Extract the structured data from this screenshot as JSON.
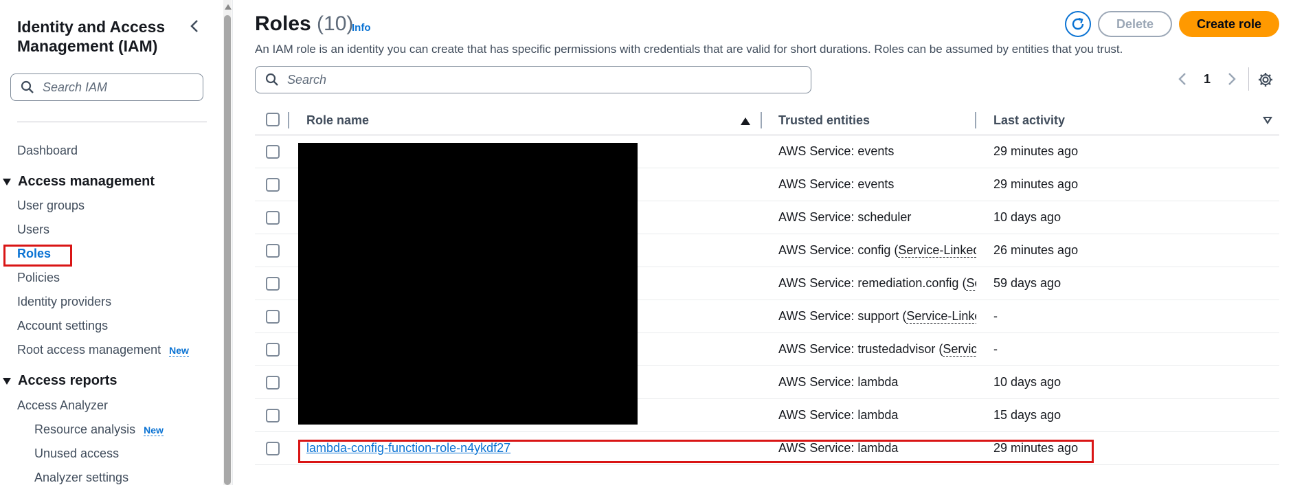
{
  "sidebar": {
    "title": "Identity and Access Management (IAM)",
    "search_placeholder": "Search IAM",
    "dashboard": "Dashboard",
    "access_management": {
      "heading": "Access management",
      "items": [
        "User groups",
        "Users",
        "Roles",
        "Policies",
        "Identity providers",
        "Account settings",
        "Root access management"
      ],
      "new_badge": "New"
    },
    "access_reports": {
      "heading": "Access reports",
      "analyzer": "Access Analyzer",
      "sub_items": [
        "Resource analysis",
        "Unused access",
        "Analyzer settings"
      ],
      "new_badge": "New"
    }
  },
  "header": {
    "title": "Roles",
    "count": "(10)",
    "info": "Info",
    "description": "An IAM role is an identity you can create that has specific permissions with credentials that are valid for short durations. Roles can be assumed by entities that you trust.",
    "delete_label": "Delete",
    "create_label": "Create role"
  },
  "search": {
    "placeholder": "Search"
  },
  "pagination": {
    "current_page": "1"
  },
  "table": {
    "columns": [
      "Role name",
      "Trusted entities",
      "Last activity"
    ],
    "rows": [
      {
        "name": "",
        "trusted": "AWS Service: events",
        "trusted_suffix": "",
        "activity": "29 minutes ago"
      },
      {
        "name": "",
        "trusted": "AWS Service: events",
        "trusted_suffix": "",
        "activity": "29 minutes ago"
      },
      {
        "name": "",
        "trusted": "AWS Service: scheduler",
        "trusted_suffix": "",
        "activity": "10 days ago"
      },
      {
        "name": "",
        "trusted": "AWS Service: config (",
        "trusted_suffix": "Service-Linked",
        "activity": "26 minutes ago"
      },
      {
        "name": "",
        "trusted": "AWS Service: remediation.config (",
        "trusted_suffix": "Service-Linked",
        "activity": "59 days ago"
      },
      {
        "name": "",
        "trusted": "AWS Service: support (",
        "trusted_suffix": "Service-Linked",
        "activity": "-"
      },
      {
        "name": "",
        "trusted": "AWS Service: trustedadvisor (",
        "trusted_suffix": "Service-Linked",
        "activity": "-"
      },
      {
        "name": "",
        "trusted": "AWS Service: lambda",
        "trusted_suffix": "",
        "activity": "10 days ago"
      },
      {
        "name": "",
        "trusted": "AWS Service: lambda",
        "trusted_suffix": "",
        "activity": "15 days ago"
      },
      {
        "name": "lambda-config-function-role-n4ykdf27",
        "trusted": "AWS Service: lambda",
        "trusted_suffix": "",
        "activity": "29 minutes ago"
      }
    ]
  },
  "colors": {
    "accent": "#0972d3",
    "primary_button": "#ff9900",
    "highlight_box": "#d91515"
  }
}
